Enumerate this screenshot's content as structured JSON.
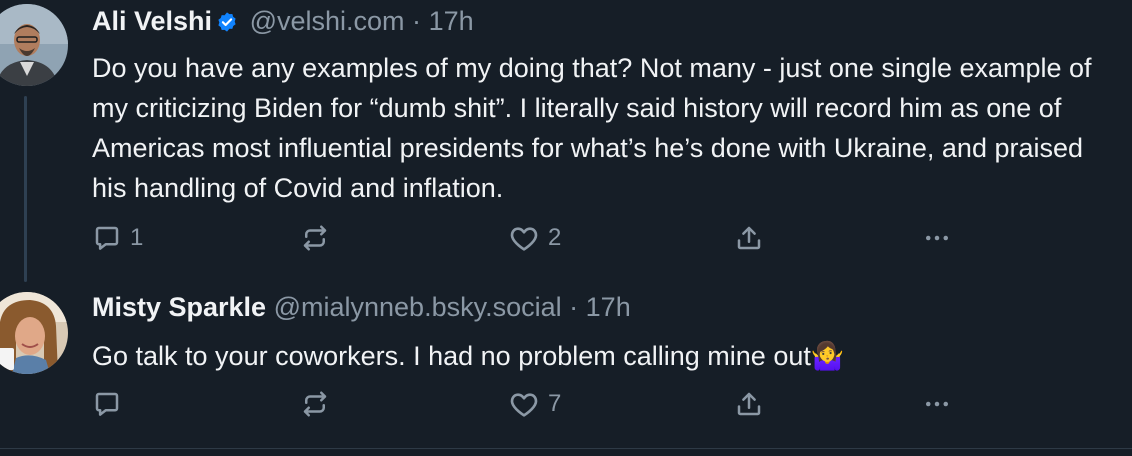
{
  "posts": [
    {
      "author_name": "Ali Velshi",
      "verified": true,
      "handle": "@velshi.com",
      "separator": "·",
      "time": "17h",
      "text": "Do you have any examples of my doing that? Not many - just one single example of my criticizing Biden for “dumb shit”. I literally said history will record him as one of Americas most influential presidents for what’s he’s done with Ukraine, and praised his handling of Covid and inflation.",
      "reply_count": "1",
      "repost_count": "",
      "like_count": "2"
    },
    {
      "author_name": "Misty Sparkle",
      "verified": false,
      "handle": "@mialynneb.bsky.social",
      "separator": "·",
      "time": "17h",
      "text": "Go talk to your coworkers. I had no problem calling mine out🤷‍♀️",
      "reply_count": "",
      "repost_count": "",
      "like_count": "7"
    }
  ],
  "icons": {
    "reply": "reply-icon",
    "repost": "repost-icon",
    "like": "heart-icon",
    "share": "share-icon",
    "more": "more-icon",
    "verified": "verified-badge-icon"
  },
  "colors": {
    "background": "#161e27",
    "text": "#f1f3f5",
    "muted": "#8b98a5",
    "verified": "#1083fe",
    "thread_line": "#2e4052"
  }
}
